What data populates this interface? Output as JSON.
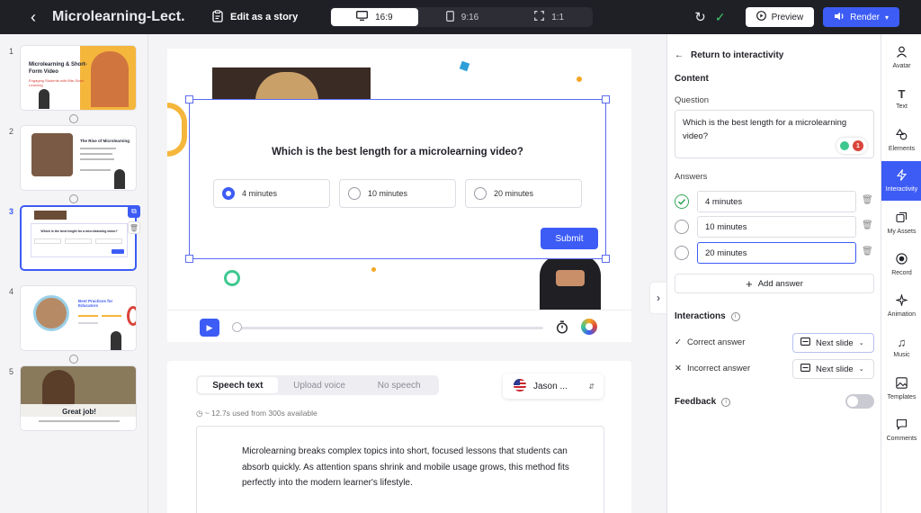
{
  "topbar": {
    "title": "Microlearning-Lect...",
    "story_label": "Edit as a story",
    "ratios": [
      "16:9",
      "9:16",
      "1:1"
    ],
    "preview_label": "Preview",
    "render_label": "Render"
  },
  "slides": [
    {
      "num": "1",
      "title": "Microlearning & Short-Form Video",
      "subtitle": "Engaging Students with Bite-Sized Learning"
    },
    {
      "num": "2",
      "title": "The Rise of Microlearning"
    },
    {
      "num": "3",
      "title": "Which is the best length for a microlearning video?"
    },
    {
      "num": "4",
      "title": "Best Practices for Educators"
    },
    {
      "num": "5",
      "title": "Great job!"
    }
  ],
  "quiz": {
    "question": "Which is the best length for a microlearning video?",
    "options": [
      "4 minutes",
      "10 minutes",
      "20 minutes"
    ],
    "submit": "Submit"
  },
  "speech": {
    "tabs": [
      "Speech text",
      "Upload voice",
      "No speech"
    ],
    "voice_name": "Jason ...",
    "usage": "~ 12.7s used from 300s available",
    "script": "Microlearning breaks complex topics into short, focused lessons that students can absorb quickly. As attention spans shrink and mobile usage grows, this method fits perfectly into the modern learner's lifestyle."
  },
  "panel": {
    "return_label": "Return to interactivity",
    "content_title": "Content",
    "question_label": "Question",
    "question_value": "Which is the best length for a microlearning video?",
    "spell_count": "1",
    "answers_label": "Answers",
    "answers": [
      "4 minutes",
      "10 minutes",
      "20 minutes"
    ],
    "add_answer": "Add answer",
    "interactions_title": "Interactions",
    "correct_label": "Correct answer",
    "incorrect_label": "Incorrect answer",
    "correct_action": "Next slide",
    "incorrect_action": "Next slide",
    "feedback_title": "Feedback"
  },
  "rail": [
    "Avatar",
    "Text",
    "Elements",
    "Interactivity",
    "My Assets",
    "Record",
    "Animation",
    "Music",
    "Templates",
    "Comments"
  ],
  "colors": {
    "accent": "#3d5cf5",
    "topbar": "#1f2026",
    "correct": "#34a85a"
  }
}
